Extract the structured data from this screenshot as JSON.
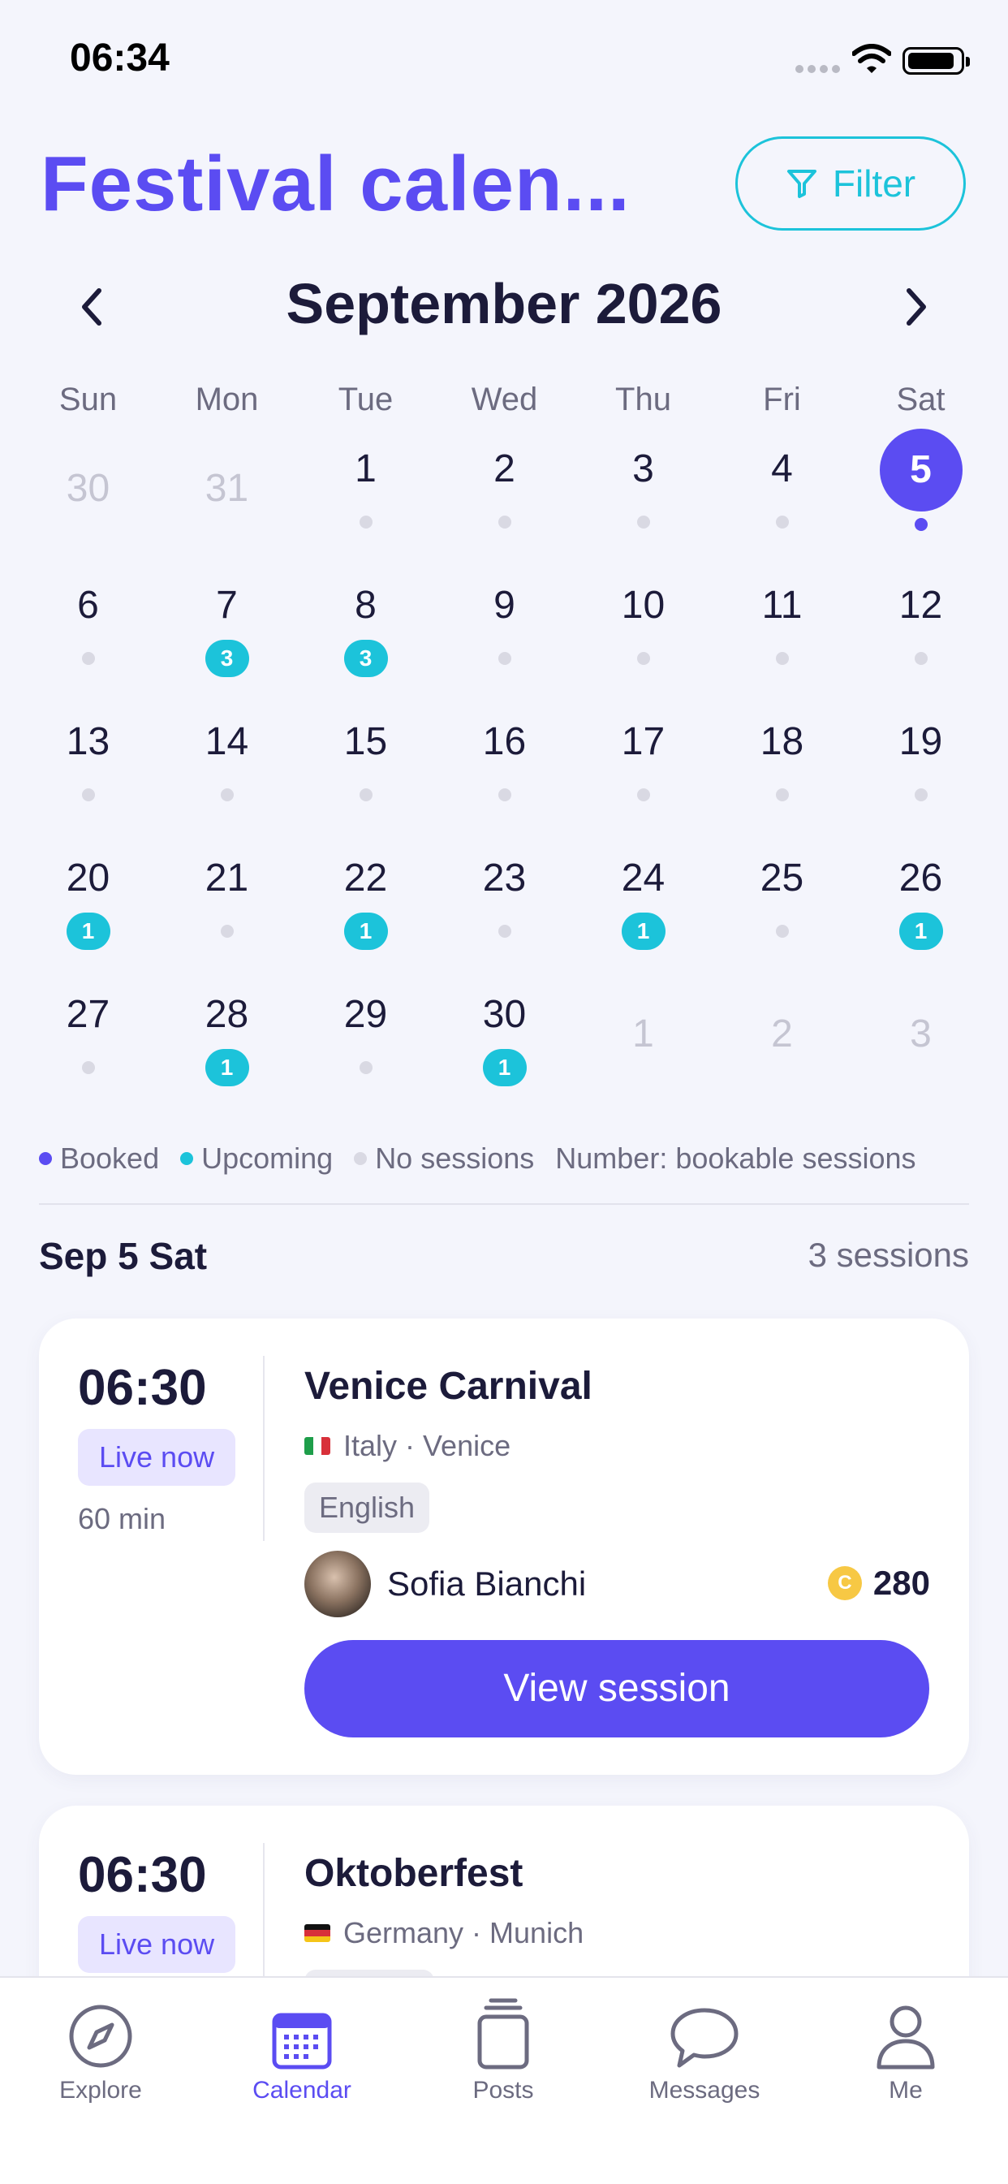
{
  "status_bar": {
    "time": "06:34"
  },
  "header": {
    "title": "Festival calen...",
    "filter_label": "Filter"
  },
  "calendar": {
    "month_label": "September 2026",
    "weekdays": [
      "Sun",
      "Mon",
      "Tue",
      "Wed",
      "Thu",
      "Fri",
      "Sat"
    ],
    "weeks": [
      [
        {
          "day": "30",
          "type": "other"
        },
        {
          "day": "31",
          "type": "other"
        },
        {
          "day": "1",
          "type": "none"
        },
        {
          "day": "2",
          "type": "none"
        },
        {
          "day": "3",
          "type": "none"
        },
        {
          "day": "4",
          "type": "none"
        },
        {
          "day": "5",
          "type": "booked",
          "selected": true
        }
      ],
      [
        {
          "day": "6",
          "type": "none"
        },
        {
          "day": "7",
          "type": "upcoming",
          "count": "3"
        },
        {
          "day": "8",
          "type": "upcoming",
          "count": "3"
        },
        {
          "day": "9",
          "type": "none"
        },
        {
          "day": "10",
          "type": "none"
        },
        {
          "day": "11",
          "type": "none"
        },
        {
          "day": "12",
          "type": "none"
        }
      ],
      [
        {
          "day": "13",
          "type": "none"
        },
        {
          "day": "14",
          "type": "none"
        },
        {
          "day": "15",
          "type": "none"
        },
        {
          "day": "16",
          "type": "none"
        },
        {
          "day": "17",
          "type": "none"
        },
        {
          "day": "18",
          "type": "none"
        },
        {
          "day": "19",
          "type": "none"
        }
      ],
      [
        {
          "day": "20",
          "type": "upcoming",
          "count": "1"
        },
        {
          "day": "21",
          "type": "none"
        },
        {
          "day": "22",
          "type": "upcoming",
          "count": "1"
        },
        {
          "day": "23",
          "type": "none"
        },
        {
          "day": "24",
          "type": "upcoming",
          "count": "1"
        },
        {
          "day": "25",
          "type": "none"
        },
        {
          "day": "26",
          "type": "upcoming",
          "count": "1"
        }
      ],
      [
        {
          "day": "27",
          "type": "none"
        },
        {
          "day": "28",
          "type": "upcoming",
          "count": "1"
        },
        {
          "day": "29",
          "type": "none"
        },
        {
          "day": "30",
          "type": "upcoming",
          "count": "1"
        },
        {
          "day": "1",
          "type": "other"
        },
        {
          "day": "2",
          "type": "other"
        },
        {
          "day": "3",
          "type": "other"
        }
      ]
    ]
  },
  "legend": {
    "booked": "Booked",
    "upcoming": "Upcoming",
    "no_sessions": "No sessions",
    "note": "Number: bookable sessions"
  },
  "day_header": {
    "date": "Sep 5 Sat",
    "count": "3 sessions"
  },
  "sessions": [
    {
      "time": "06:30",
      "status": "Live now",
      "duration": "60 min",
      "title": "Venice Carnival",
      "location": "Italy · Venice",
      "flag": "it",
      "language": "English",
      "host": "Sofia Bianchi",
      "price": "280",
      "coin_symbol": "C",
      "button": "View session"
    },
    {
      "time": "06:30",
      "status": "Live now",
      "title": "Oktoberfest",
      "location": "Germany · Munich",
      "flag": "de"
    }
  ],
  "tabs": [
    {
      "label": "Explore",
      "icon": "compass-icon"
    },
    {
      "label": "Calendar",
      "icon": "calendar-icon",
      "active": true
    },
    {
      "label": "Posts",
      "icon": "posts-icon"
    },
    {
      "label": "Messages",
      "icon": "chat-bubble-icon"
    },
    {
      "label": "Me",
      "icon": "person-icon"
    }
  ],
  "colors": {
    "accent": "#5b4cf2",
    "upcoming": "#1cc3da",
    "no_sessions": "#d9d9e3",
    "background": "#f4f5fc"
  }
}
